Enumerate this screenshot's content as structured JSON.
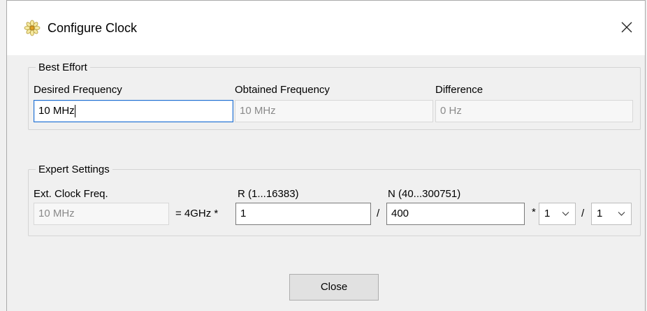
{
  "window": {
    "title": "Configure Clock",
    "icon": "flower-gear-icon"
  },
  "best_effort": {
    "legend": "Best Effort",
    "desired": {
      "label": "Desired Frequency",
      "value": "10 MHz"
    },
    "obtained": {
      "label": "Obtained Frequency",
      "value": "10 MHz"
    },
    "difference": {
      "label": "Difference",
      "value": "0 Hz"
    }
  },
  "expert": {
    "legend": "Expert Settings",
    "ext_clock": {
      "label": "Ext. Clock Freq.",
      "value": "10 MHz"
    },
    "multiplier_text": "= 4GHz *",
    "r": {
      "label": "R (1...16383)",
      "value": "1"
    },
    "div1": "/",
    "n": {
      "label": "N (40...300751)",
      "value": "400"
    },
    "mult": "*",
    "select1": {
      "value": "1"
    },
    "div2": "/",
    "select2": {
      "value": "1"
    }
  },
  "buttons": {
    "close": "Close"
  },
  "colors": {
    "focus_border": "#1f6fd0",
    "title_bg": "#ffffff",
    "window_bg": "#f0f0f0"
  }
}
